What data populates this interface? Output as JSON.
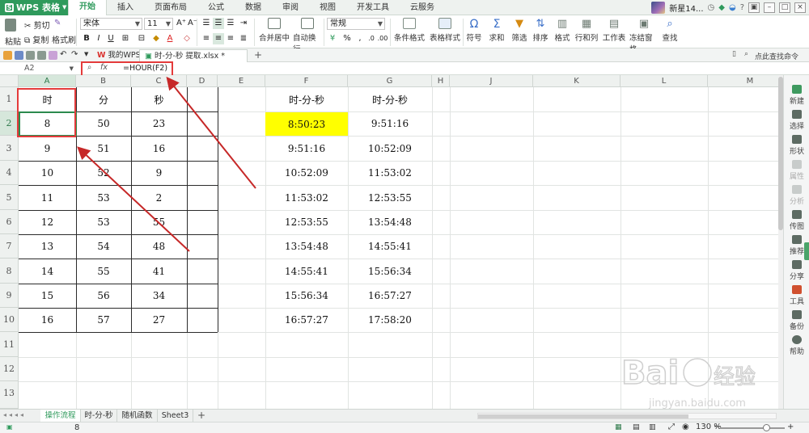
{
  "app": {
    "name": "WPS 表格"
  },
  "menu_tabs": [
    "开始",
    "插入",
    "页面布局",
    "公式",
    "数据",
    "审阅",
    "视图",
    "开发工具",
    "云服务"
  ],
  "user": {
    "name": "新星14..."
  },
  "ribbon": {
    "cut": "剪切",
    "paste": "粘贴",
    "copy": "复制",
    "format_painter": "格式刷",
    "font_name": "宋体",
    "font_size": "11",
    "merge_center": "合并居中",
    "wrap_text": "自动换行",
    "number_format": "常规",
    "conditional_format": "条件格式",
    "table_style": "表格样式",
    "symbol": "符号",
    "sum": "求和",
    "filter": "筛选",
    "sort": "排序",
    "format": "格式",
    "rows_cols": "行和列",
    "worksheet": "工作表",
    "freeze": "冻结窗格",
    "find": "查找"
  },
  "doc_tabs": {
    "my_wps": "我的WPS",
    "file": "时-分-秒 提取.xlsx *",
    "search_hint": "点此查找命令"
  },
  "formula_bar": {
    "cell_ref": "A2",
    "fx": "fx",
    "formula": "=HOUR(F2)"
  },
  "columns": [
    "A",
    "B",
    "C",
    "D",
    "E",
    "F",
    "G",
    "H",
    "J",
    "K",
    "L",
    "M"
  ],
  "rows": [
    "1",
    "2",
    "3",
    "4",
    "5",
    "6",
    "7",
    "8",
    "9",
    "10",
    "11",
    "12",
    "13"
  ],
  "table": {
    "headers": [
      "时",
      "分",
      "秒"
    ],
    "rows": [
      [
        "8",
        "50",
        "23"
      ],
      [
        "9",
        "51",
        "16"
      ],
      [
        "10",
        "52",
        "9"
      ],
      [
        "11",
        "53",
        "2"
      ],
      [
        "12",
        "53",
        "55"
      ],
      [
        "13",
        "54",
        "48"
      ],
      [
        "14",
        "55",
        "41"
      ],
      [
        "15",
        "56",
        "34"
      ],
      [
        "16",
        "57",
        "27"
      ]
    ]
  },
  "times": {
    "headers": [
      "时-分-秒",
      "时-分-秒"
    ],
    "rows": [
      [
        "8:50:23",
        "9:51:16"
      ],
      [
        "9:51:16",
        "10:52:09"
      ],
      [
        "10:52:09",
        "11:53:02"
      ],
      [
        "11:53:02",
        "12:53:55"
      ],
      [
        "12:53:55",
        "13:54:48"
      ],
      [
        "13:54:48",
        "14:55:41"
      ],
      [
        "14:55:41",
        "15:56:34"
      ],
      [
        "15:56:34",
        "16:57:27"
      ],
      [
        "16:57:27",
        "17:58:20"
      ]
    ]
  },
  "sidebar": [
    "新建",
    "选择",
    "形状",
    "属性",
    "分析",
    "传图",
    "推荐",
    "分享",
    "工具",
    "备份",
    "帮助"
  ],
  "sheet_tabs": [
    "操作流程",
    "时-分-秒",
    "随机函数",
    "Sheet3"
  ],
  "status": {
    "value": "8",
    "zoom": "130 %"
  },
  "colors": {
    "accent": "#2f9a5c",
    "highlight": "#ffff00",
    "annotation": "#e43b3b"
  }
}
